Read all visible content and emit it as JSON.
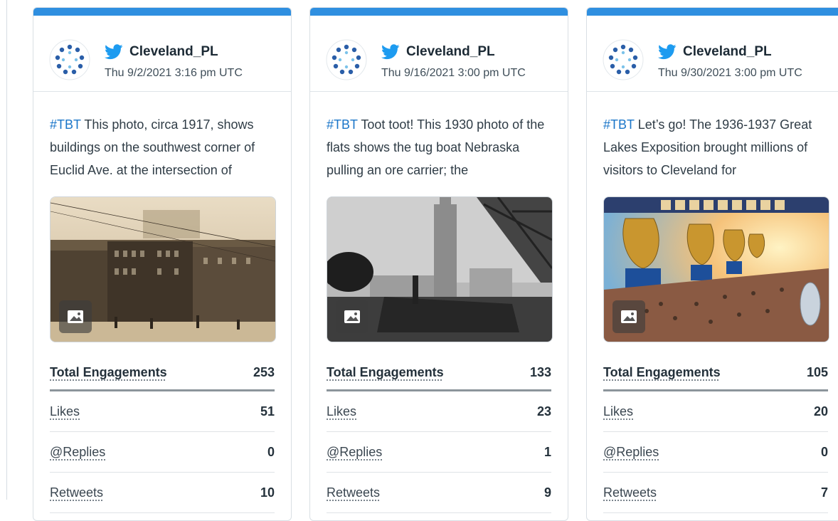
{
  "posts": [
    {
      "account": "Cleveland_PL",
      "timestamp": "Thu 9/2/2021 3:16 pm UTC",
      "hashtag": "#TBT",
      "text": " This photo, circa 1917, shows buildings on the southwest corner of Euclid Ave. at the intersection of",
      "stats": {
        "total_label": "Total Engagements",
        "total": "253",
        "likes_label": "Likes",
        "likes": "51",
        "replies_label": "@Replies",
        "replies": "0",
        "retweets_label": "Retweets",
        "retweets": "10"
      }
    },
    {
      "account": "Cleveland_PL",
      "timestamp": "Thu 9/16/2021 3:00 pm UTC",
      "hashtag": "#TBT",
      "text": " Toot toot! This 1930 photo of the flats shows the tug boat Nebraska pulling an ore carrier; the",
      "stats": {
        "total_label": "Total Engagements",
        "total": "133",
        "likes_label": "Likes",
        "likes": "23",
        "replies_label": "@Replies",
        "replies": "1",
        "retweets_label": "Retweets",
        "retweets": "9"
      }
    },
    {
      "account": "Cleveland_PL",
      "timestamp": "Thu 9/30/2021 3:00 pm UTC",
      "hashtag": "#TBT",
      "text": " Let’s go! The 1936-1937 Great Lakes Exposition brought millions of visitors to Cleveland for",
      "stats": {
        "total_label": "Total Engagements",
        "total": "105",
        "likes_label": "Likes",
        "likes": "20",
        "replies_label": "@Replies",
        "replies": "0",
        "retweets_label": "Retweets",
        "retweets": "7"
      }
    }
  ],
  "colors": {
    "accent_bar": "#2f8fe0",
    "hashtag": "#1b76c9",
    "twitter_blue": "#1d9bf0"
  },
  "icons": {
    "avatar": "cpl-logo-icon",
    "network": "twitter-bird-icon",
    "media": "image-icon"
  }
}
